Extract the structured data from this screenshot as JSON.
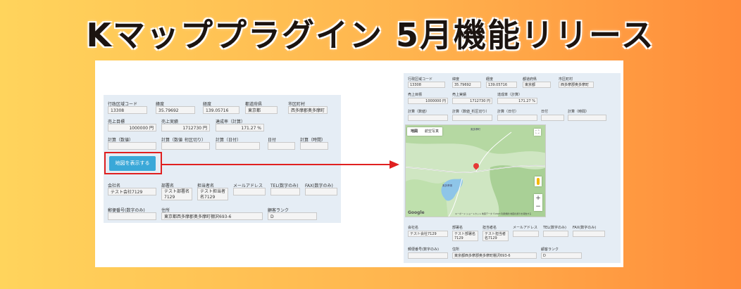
{
  "banner": {
    "title": "Kマッププラグイン 5月機能リリース",
    "colors": {
      "gradient_start": "#ffd45c",
      "gradient_end": "#ff8c3a",
      "arrow": "#e02020",
      "button": "#3aa8d8"
    }
  },
  "form": {
    "row1_labels": [
      "行政区域コード",
      "緯度",
      "経度",
      "都道府県",
      "市区町村"
    ],
    "row1_values": [
      "13308",
      "35.79692",
      "139.05716",
      "東京都",
      "西多摩郡奥多摩町"
    ],
    "row2_labels": [
      "売上目標",
      "売上実績",
      "達成率（計算）"
    ],
    "row2_values": [
      "1000000 円",
      "1712730 円",
      "171.27 %"
    ],
    "row3_labels": [
      "計算（数値）",
      "計算（数値_桁区切り）",
      "計算（日付）",
      "日付",
      "計算（時間）"
    ],
    "show_map_button": "地図を表示する",
    "row4_labels": [
      "会社名",
      "部署名",
      "担当者名",
      "メールアドレス",
      "TEL(数字のみ)",
      "FAX(数字のみ)"
    ],
    "row4_values": [
      "テスト会社7129",
      "テスト部署名7129",
      "テスト担当者名7129",
      "",
      "",
      ""
    ],
    "row5_labels": [
      "郵便番号(数字のみ)",
      "住所",
      "顧客ランク"
    ],
    "row5_values": [
      "",
      "東京都西多摩郡奥多摩町棚沢693-6",
      "D"
    ]
  },
  "map": {
    "tabs": [
      "地図",
      "航空写真"
    ],
    "active_tab": "地図",
    "zoom_in": "+",
    "zoom_out": "−",
    "fullscreen_icon": "fullscreen-icon",
    "pegman_icon": "pegman-icon",
    "pin_icon": "map-pin-icon",
    "google_logo": "Google",
    "place_labels": [
      "奥多摩町",
      "奥多摩湖"
    ],
    "credit": "キーボード ショートカット 地図データ ©2023 利用規約 地図の誤りを報告する"
  }
}
